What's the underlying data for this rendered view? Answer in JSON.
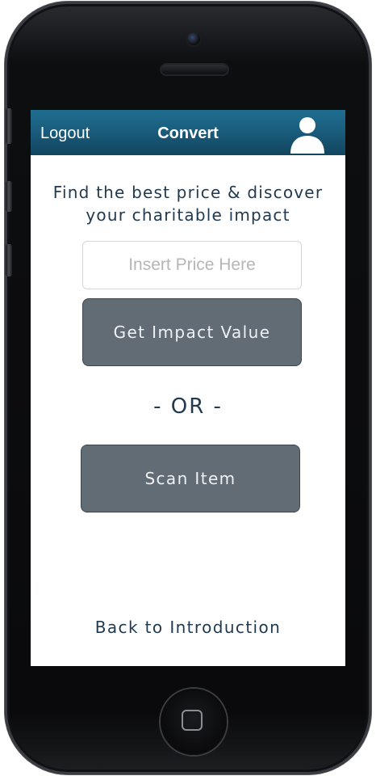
{
  "nav": {
    "logout_label": "Logout",
    "title": "Convert",
    "profile_icon": "user-silhouette-icon"
  },
  "main": {
    "tagline": "Find the best price & discover\nyour charitable impact",
    "price_input": {
      "placeholder": "Insert Price Here",
      "value": ""
    },
    "impact_button_label": "Get Impact Value",
    "or_separator": "- OR -",
    "scan_button_label": "Scan Item",
    "back_link_label": "Back to Introduction"
  },
  "colors": {
    "nav_bar": "#1a5d7d",
    "button_fill": "#626c75",
    "text_dark": "#213a4f"
  }
}
